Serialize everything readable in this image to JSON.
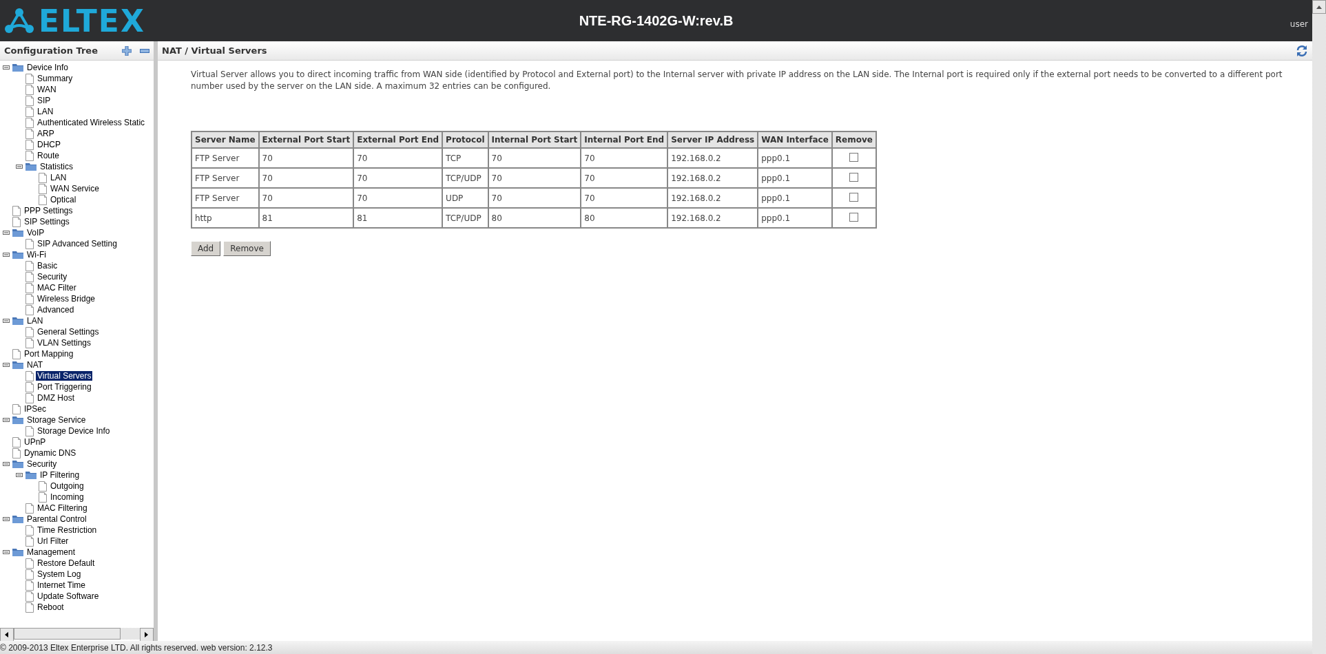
{
  "header": {
    "logo_text": "ELTEX",
    "title": "NTE-RG-1402G-W:rev.B",
    "user": "user"
  },
  "sidebar": {
    "title": "Configuration Tree",
    "items": [
      {
        "label": "Device Info",
        "kind": "folder",
        "expanded": true,
        "selected": false,
        "children": [
          {
            "label": "Summary",
            "kind": "page",
            "selected": false
          },
          {
            "label": "WAN",
            "kind": "page",
            "selected": false
          },
          {
            "label": "SIP",
            "kind": "page",
            "selected": false
          },
          {
            "label": "LAN",
            "kind": "page",
            "selected": false
          },
          {
            "label": "Authenticated Wireless Static",
            "kind": "page",
            "selected": false
          },
          {
            "label": "ARP",
            "kind": "page",
            "selected": false
          },
          {
            "label": "DHCP",
            "kind": "page",
            "selected": false
          },
          {
            "label": "Route",
            "kind": "page",
            "selected": false
          },
          {
            "label": "Statistics",
            "kind": "folder",
            "expanded": true,
            "selected": false,
            "children": [
              {
                "label": "LAN",
                "kind": "page",
                "selected": false
              },
              {
                "label": "WAN Service",
                "kind": "page",
                "selected": false
              },
              {
                "label": "Optical",
                "kind": "page",
                "selected": false
              }
            ]
          }
        ]
      },
      {
        "label": "PPP Settings",
        "kind": "page",
        "selected": false
      },
      {
        "label": "SIP Settings",
        "kind": "page",
        "selected": false
      },
      {
        "label": "VoIP",
        "kind": "folder",
        "expanded": true,
        "selected": false,
        "children": [
          {
            "label": "SIP Advanced Setting",
            "kind": "page",
            "selected": false
          }
        ]
      },
      {
        "label": "Wi-Fi",
        "kind": "folder",
        "expanded": true,
        "selected": false,
        "children": [
          {
            "label": "Basic",
            "kind": "page",
            "selected": false
          },
          {
            "label": "Security",
            "kind": "page",
            "selected": false
          },
          {
            "label": "MAC Filter",
            "kind": "page",
            "selected": false
          },
          {
            "label": "Wireless Bridge",
            "kind": "page",
            "selected": false
          },
          {
            "label": "Advanced",
            "kind": "page",
            "selected": false
          }
        ]
      },
      {
        "label": "LAN",
        "kind": "folder",
        "expanded": true,
        "selected": false,
        "children": [
          {
            "label": "General Settings",
            "kind": "page",
            "selected": false
          },
          {
            "label": "VLAN Settings",
            "kind": "page",
            "selected": false
          }
        ]
      },
      {
        "label": "Port Mapping",
        "kind": "page",
        "selected": false
      },
      {
        "label": "NAT",
        "kind": "folder",
        "expanded": true,
        "selected": false,
        "children": [
          {
            "label": "Virtual Servers",
            "kind": "page",
            "selected": true
          },
          {
            "label": "Port Triggering",
            "kind": "page",
            "selected": false
          },
          {
            "label": "DMZ Host",
            "kind": "page",
            "selected": false
          }
        ]
      },
      {
        "label": "IPSec",
        "kind": "page",
        "selected": false
      },
      {
        "label": "Storage Service",
        "kind": "folder",
        "expanded": true,
        "selected": false,
        "children": [
          {
            "label": "Storage Device Info",
            "kind": "page",
            "selected": false
          }
        ]
      },
      {
        "label": "UPnP",
        "kind": "page",
        "selected": false
      },
      {
        "label": "Dynamic DNS",
        "kind": "page",
        "selected": false
      },
      {
        "label": "Security",
        "kind": "folder",
        "expanded": true,
        "selected": false,
        "children": [
          {
            "label": "IP Filtering",
            "kind": "folder",
            "expanded": true,
            "selected": false,
            "children": [
              {
                "label": "Outgoing",
                "kind": "page",
                "selected": false
              },
              {
                "label": "Incoming",
                "kind": "page",
                "selected": false
              }
            ]
          },
          {
            "label": "MAC Filtering",
            "kind": "page",
            "selected": false
          }
        ]
      },
      {
        "label": "Parental Control",
        "kind": "folder",
        "expanded": true,
        "selected": false,
        "children": [
          {
            "label": "Time Restriction",
            "kind": "page",
            "selected": false
          },
          {
            "label": "Url Filter",
            "kind": "page",
            "selected": false
          }
        ]
      },
      {
        "label": "Management",
        "kind": "folder",
        "expanded": true,
        "selected": false,
        "children": [
          {
            "label": "Restore Default",
            "kind": "page",
            "selected": false
          },
          {
            "label": "System Log",
            "kind": "page",
            "selected": false
          },
          {
            "label": "Internet Time",
            "kind": "page",
            "selected": false
          },
          {
            "label": "Update Software",
            "kind": "page",
            "selected": false
          },
          {
            "label": "Reboot",
            "kind": "page",
            "selected": false
          }
        ]
      }
    ]
  },
  "content": {
    "title": "NAT / Virtual Servers",
    "description": "Virtual Server allows you to direct incoming traffic from WAN side (identified by Protocol and External port) to the Internal server with private IP address on the LAN side. The Internal port is required only if the external port needs to be converted to a different port number used by the server on the LAN side. A maximum 32 entries can be configured.",
    "table": {
      "columns": [
        "Server Name",
        "External Port Start",
        "External Port End",
        "Protocol",
        "Internal Port Start",
        "Internal Port End",
        "Server IP Address",
        "WAN Interface",
        "Remove"
      ],
      "rows": [
        {
          "cells": [
            "FTP Server",
            "70",
            "70",
            "TCP",
            "70",
            "70",
            "192.168.0.2",
            "ppp0.1"
          ],
          "checked": false
        },
        {
          "cells": [
            "FTP Server",
            "70",
            "70",
            "TCP/UDP",
            "70",
            "70",
            "192.168.0.2",
            "ppp0.1"
          ],
          "checked": false
        },
        {
          "cells": [
            "FTP Server",
            "70",
            "70",
            "UDP",
            "70",
            "70",
            "192.168.0.2",
            "ppp0.1"
          ],
          "checked": false
        },
        {
          "cells": [
            "http",
            "81",
            "81",
            "TCP/UDP",
            "80",
            "80",
            "192.168.0.2",
            "ppp0.1"
          ],
          "checked": false
        }
      ]
    },
    "buttons": [
      "Add",
      "Remove"
    ]
  },
  "footer": "© 2009-2013 Eltex Enterprise LTD. All rights reserved. web version: 2.12.3"
}
